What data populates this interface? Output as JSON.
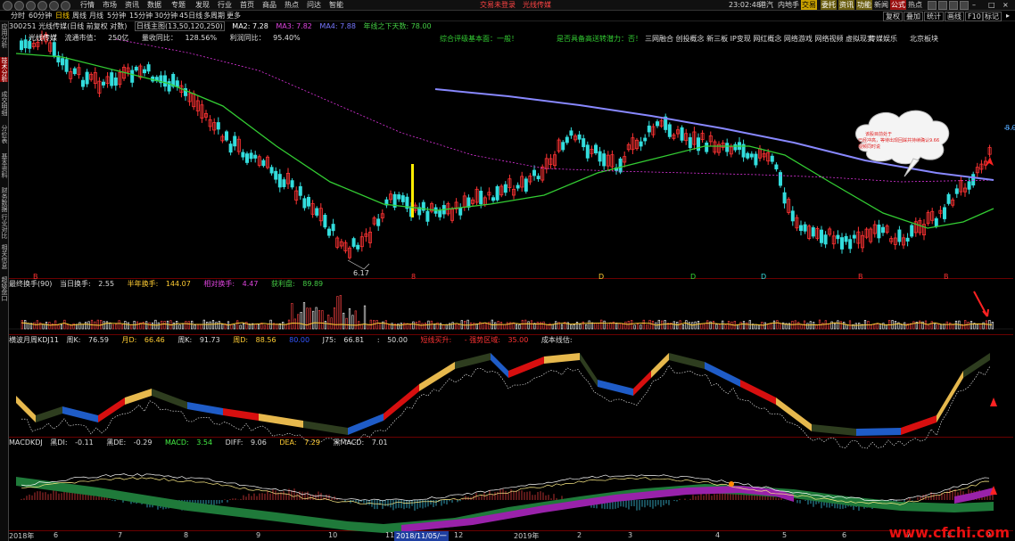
{
  "topbar": {
    "nav": [
      "行情",
      "市场",
      "资讯",
      "数据",
      "专题",
      "发现",
      "行业",
      "首页",
      "商品",
      "热点",
      "问达",
      "智能"
    ],
    "ticker": [
      "交易未登录",
      "光线传媒"
    ],
    "time": "23:02:48",
    "right_labels": [
      "港汽",
      "内地手"
    ],
    "buttons": [
      "交易",
      "委托",
      "资讯",
      "功能",
      "新闻",
      "公式",
      "热点"
    ]
  },
  "periodbar": {
    "periods": [
      "分时",
      "60分钟",
      "日线",
      "周线",
      "月线",
      "5分钟",
      "15分钟",
      "30分钟",
      "45日线",
      "多周期",
      "更多"
    ],
    "selected": "日线",
    "right_buttons": [
      "复权",
      "叠加",
      "统计",
      "画线",
      "F10",
      "标记"
    ]
  },
  "leftrail": {
    "tabs": [
      "应用分析",
      "技术分析",
      "成交明细",
      "分价表",
      "基本资料",
      "财务数据",
      "行业对比",
      "相关信息",
      "超级盘口"
    ],
    "active": "技术分析"
  },
  "main": {
    "header": {
      "code_name": "300251 光线传媒(日线 前复权 对数)",
      "ma_title": "日线主图(13,50,120,250)",
      "ma2": "MA2: 7.28",
      "ma3": "MA3: 7.82",
      "ma4": "MA4: 7.88",
      "ma_extra": "年线之下天数: 78.00"
    },
    "info_row": {
      "items": [
        "光线传媒",
        "流通市值：",
        "250亿",
        "量收同比：",
        "128.56%",
        "利润同比：",
        "95.40%"
      ]
    },
    "themes": {
      "left": "综合评级基本面：一般！",
      "mid": "是否具备高送转潜力：否！",
      "tags": [
        "三网融合",
        "创投概念",
        "新三板",
        "IP变现",
        "网红概念",
        "网络游戏",
        "网络视频",
        "虚拟现实"
      ],
      "extra1": "传媒娱乐",
      "extra2": "北京板块"
    },
    "low_label": "6.17",
    "right_price": "8.9",
    "cloud_lines": [
      "该股目前处于",
      "已经冲高，等待出现回踩并持续确认9.66",
      "视频同时说"
    ],
    "date_markers": [
      "B",
      "8",
      "D",
      "D",
      "D",
      "B",
      "B"
    ]
  },
  "vol_panel": {
    "title": "最终换手(90)",
    "items": [
      {
        "label": "当日换手:",
        "value": "2.55",
        "color": "#dcdcdc"
      },
      {
        "label": "半年换手:",
        "value": "144.07",
        "color": "#ffcc33"
      },
      {
        "label": "相对换手:",
        "value": "4.47",
        "color": "#dd44dd"
      },
      {
        "label": "获利盘:",
        "value": "89.89",
        "color": "#44cc44"
      }
    ]
  },
  "kdj_panel": {
    "title": "横波月周KDJ11",
    "items": [
      {
        "label": "周K:",
        "value": "76.59",
        "color": "#dcdcdc"
      },
      {
        "label": "月D:",
        "value": "66.46",
        "color": "#ffcc33"
      },
      {
        "label": "周K:",
        "value": "91.73",
        "color": "#dcdcdc"
      },
      {
        "label": "周D:",
        "value": "88.56",
        "color": "#ffcc33"
      },
      {
        "label": "80.00",
        "value": "",
        "color": "#3355ff"
      },
      {
        "label": "J75:",
        "value": "66.81",
        "color": "#dcdcdc"
      },
      {
        "label": ":",
        "value": "50.00",
        "color": "#dcdcdc"
      },
      {
        "label": "短线买升:",
        "value": "",
        "color": "#ff3333"
      },
      {
        "label": "- 强势区域:",
        "value": "35.00",
        "color": "#ff3333"
      },
      {
        "label": "成本线估:",
        "value": "",
        "color": "#dcdcdc"
      }
    ]
  },
  "macd_panel": {
    "title": "MACDKDJ",
    "items": [
      {
        "label": "黑DI:",
        "value": "-0.11",
        "color": "#dcdcdc"
      },
      {
        "label": "黑DE:",
        "value": "-0.29",
        "color": "#dcdcdc"
      },
      {
        "label": "MACD:",
        "value": "3.54",
        "color": "#44ee44"
      },
      {
        "label": "DIFF:",
        "value": "9.06",
        "color": "#dcdcdc"
      },
      {
        "label": "DEA:",
        "value": "7.29",
        "color": "#ffcc33"
      },
      {
        "label": "黑MACD:",
        "value": "7.01",
        "color": "#dcdcdc"
      }
    ]
  },
  "xaxis": {
    "labels": [
      "2018年",
      "6",
      "7",
      "8",
      "9",
      "10",
      "11",
      "12",
      "2019年",
      "2",
      "3",
      "4",
      "5",
      "6",
      "7",
      "8",
      "9"
    ],
    "cursor_date": "2018/11/05/一"
  },
  "watermark": "www.cfchi.com",
  "colors": {
    "up": "#ff3333",
    "down": "#33dddd",
    "ma_green": "#33cc33",
    "ma_blue": "#7777ff",
    "ma_pink": "#dd33dd",
    "panel_border": "#6b0000"
  }
}
